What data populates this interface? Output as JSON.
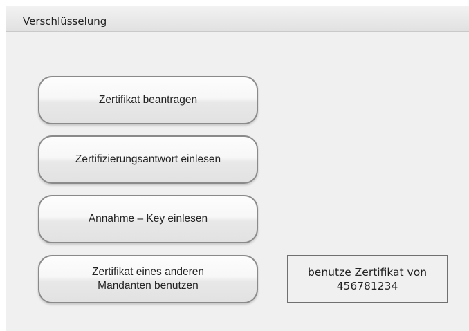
{
  "panel": {
    "title": "Verschlüsselung"
  },
  "buttons": {
    "request_certificate": "Zertifikat beantragen",
    "read_certification_response": "Zertifizierungsantwort einlesen",
    "read_acceptance_key": "Annahme – Key einlesen",
    "use_other_client_certificate": "Zertifikat eines anderen\nMandanten benutzen"
  },
  "info": {
    "certificate_in_use": "benutze Zertifikat von\n456781234"
  }
}
